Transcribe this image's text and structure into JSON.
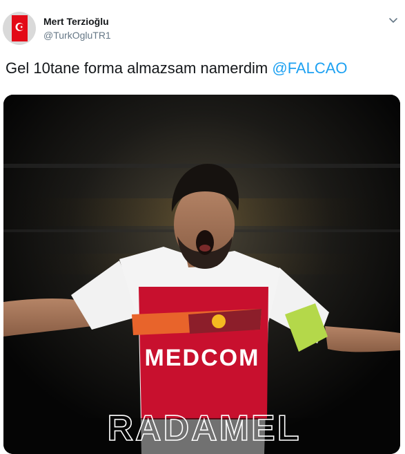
{
  "tweet": {
    "display_name": "Mert Terzioğlu",
    "handle": "@TurkOgluTR1",
    "text": "Gel 10tane forma almazsam namerdim ",
    "mention": "@FALCAO"
  },
  "media": {
    "sponsor_text": "MEDCOM",
    "overlay_name": "RADAMEL"
  },
  "colors": {
    "mention": "#1da1f2",
    "jersey_red": "#c8102e",
    "flag_red": "#e30a17"
  },
  "icons": {
    "menu": "chevron-down-icon",
    "avatar": "turkish-flag-icon"
  }
}
